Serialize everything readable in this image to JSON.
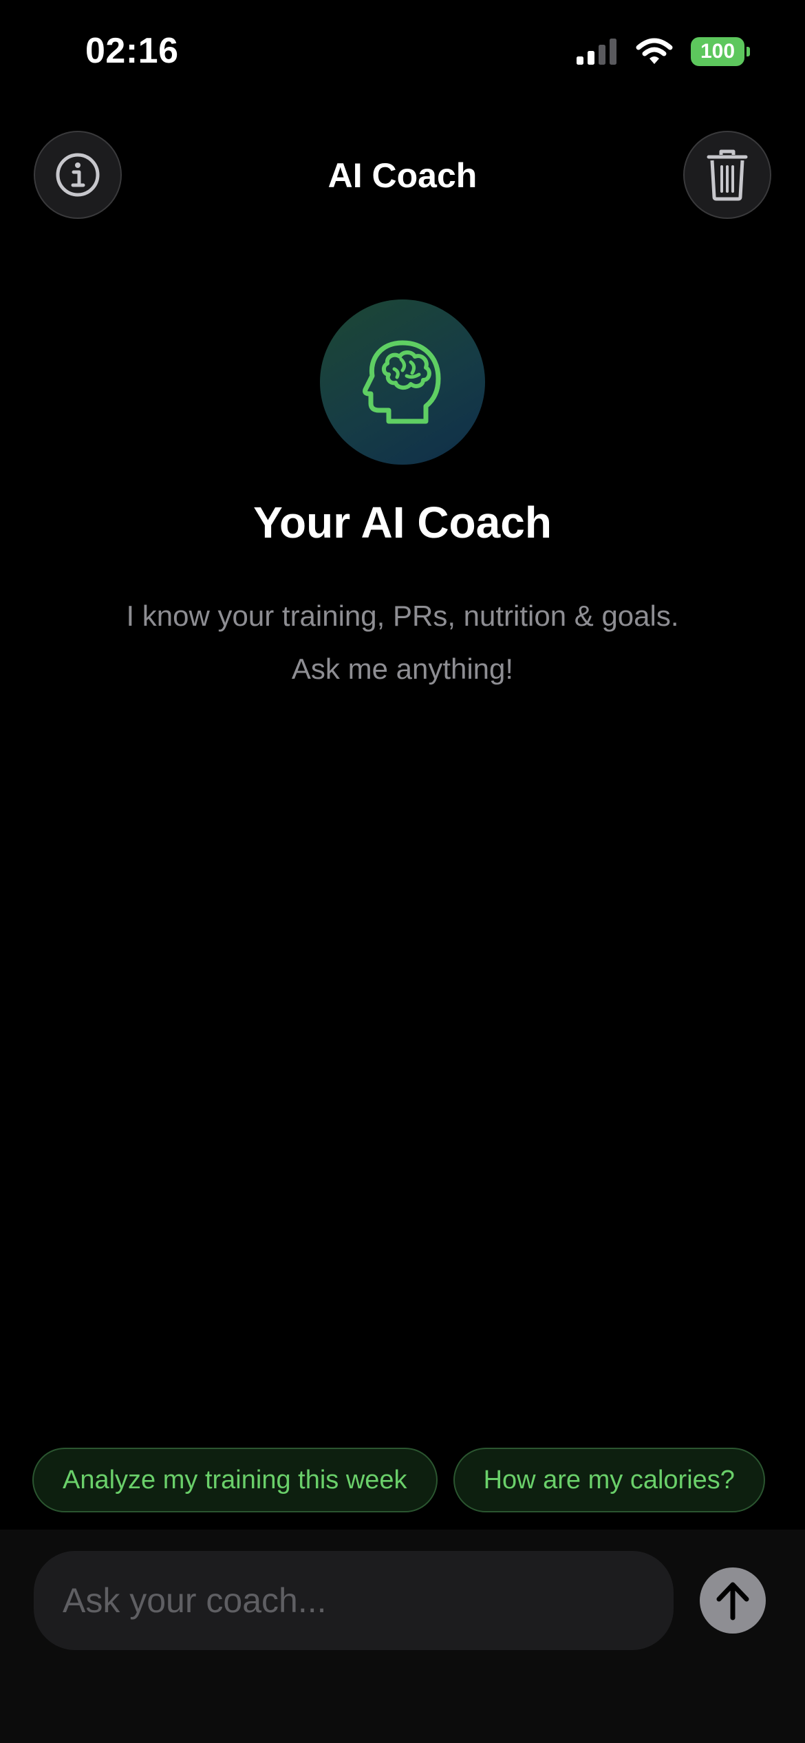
{
  "status_bar": {
    "time": "02:16",
    "battery": "100",
    "icons": [
      "cellular-signal-icon",
      "wifi-icon",
      "battery-icon"
    ]
  },
  "header": {
    "title": "AI Coach",
    "left_icon": "info-icon",
    "right_icon": "trash-icon"
  },
  "hero": {
    "icon": "brain-head-icon",
    "title": "Your AI Coach",
    "subtitle_line1": "I know your training, PRs, nutrition & goals.",
    "subtitle_line2": "Ask me anything!"
  },
  "suggestions": [
    {
      "label": "Analyze my training this week"
    },
    {
      "label": "How are my calories?"
    }
  ],
  "composer": {
    "placeholder": "Ask your coach...",
    "value": "",
    "send_icon": "arrow-up-icon"
  },
  "colors": {
    "background": "#000000",
    "accent_green": "#5dc75d",
    "muted_text": "#8e8e93"
  }
}
